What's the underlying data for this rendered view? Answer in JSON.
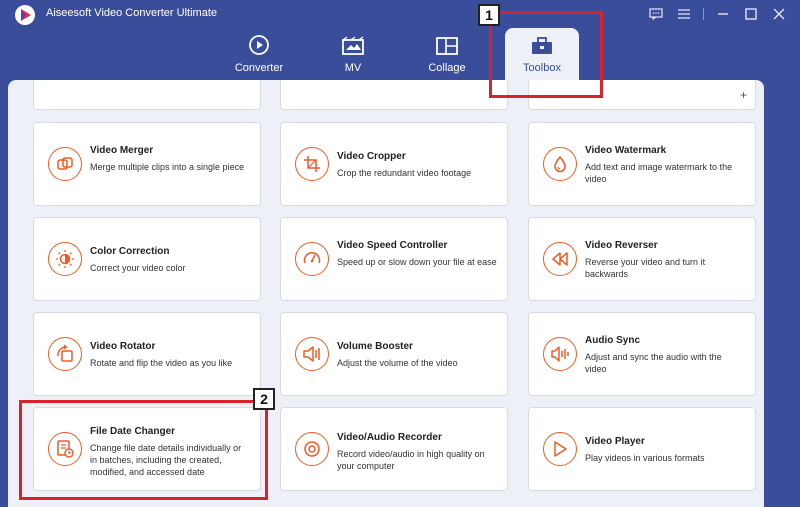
{
  "app": {
    "title": "Aiseesoft Video Converter Ultimate"
  },
  "window_controls": [
    {
      "name": "feedback-icon",
      "glyph": "▭"
    },
    {
      "name": "menu-icon",
      "glyph": "≡"
    },
    {
      "name": "minimize-icon",
      "glyph": "—"
    },
    {
      "name": "maximize-icon",
      "glyph": "☐"
    },
    {
      "name": "close-icon",
      "glyph": "✕"
    }
  ],
  "tabs": [
    {
      "label": "Converter",
      "icon": "converter-icon",
      "active": false
    },
    {
      "label": "MV",
      "icon": "mv-icon",
      "active": false
    },
    {
      "label": "Collage",
      "icon": "collage-icon",
      "active": false
    },
    {
      "label": "Toolbox",
      "icon": "toolbox-icon",
      "active": true
    }
  ],
  "tools": [
    {
      "title": "Video Merger",
      "desc": "Merge multiple clips into a single piece",
      "icon": "merge-icon"
    },
    {
      "title": "Video Cropper",
      "desc": "Crop the redundant video footage",
      "icon": "crop-icon"
    },
    {
      "title": "Video Watermark",
      "desc": "Add text and image watermark to the video",
      "icon": "watermark-icon"
    },
    {
      "title": "Color Correction",
      "desc": "Correct your video color",
      "icon": "color-correction-icon"
    },
    {
      "title": "Video Speed Controller",
      "desc": "Speed up or slow down your file at ease",
      "icon": "speed-gauge-icon"
    },
    {
      "title": "Video Reverser",
      "desc": "Reverse your video and turn it backwards",
      "icon": "rewind-icon"
    },
    {
      "title": "Video Rotator",
      "desc": "Rotate and flip the video as you like",
      "icon": "rotate-icon"
    },
    {
      "title": "Volume Booster",
      "desc": "Adjust the volume of the video",
      "icon": "volume-boost-icon"
    },
    {
      "title": "Audio Sync",
      "desc": "Adjust and sync the audio with the video",
      "icon": "audio-sync-icon"
    },
    {
      "title": "File Date Changer",
      "desc": "Change file date details individually or in batches, including the created, modified, and accessed date",
      "icon": "file-date-icon"
    },
    {
      "title": "Video/Audio Recorder",
      "desc": "Record video/audio in high quality on your computer",
      "icon": "recorder-icon"
    },
    {
      "title": "Video Player",
      "desc": "Play videos in various formats",
      "icon": "play-icon"
    }
  ],
  "annotations": [
    {
      "number": "1"
    },
    {
      "number": "2"
    }
  ],
  "colors": {
    "brand": "#3a4d9a",
    "accent": "#f05a23",
    "highlight": "#d9232a"
  }
}
